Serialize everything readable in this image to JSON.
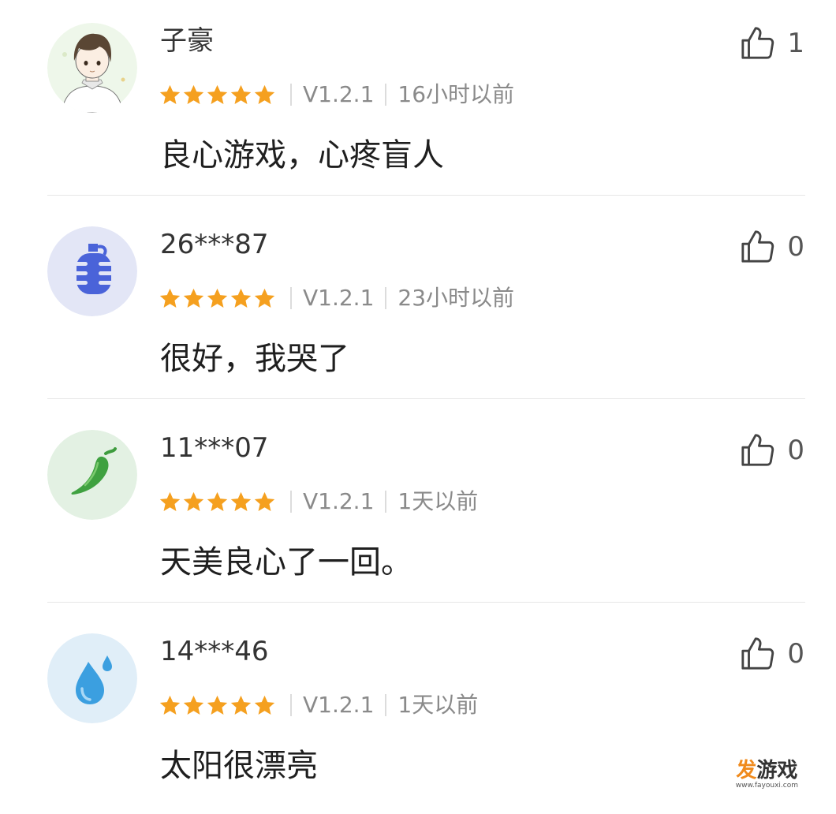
{
  "reviews": [
    {
      "username": "子豪",
      "avatar_icon": "boy-portrait-icon",
      "rating": 5,
      "version": "V1.2.1",
      "time": "16小时以前",
      "comment": "良心游戏，心疼盲人",
      "likes": "1"
    },
    {
      "username": "26***87",
      "avatar_icon": "grenade-icon",
      "rating": 5,
      "version": "V1.2.1",
      "time": "23小时以前",
      "comment": "很好，我哭了",
      "likes": "0"
    },
    {
      "username": "11***07",
      "avatar_icon": "chili-pepper-icon",
      "rating": 5,
      "version": "V1.2.1",
      "time": "1天以前",
      "comment": "天美良心了一回。",
      "likes": "0"
    },
    {
      "username": "14***46",
      "avatar_icon": "water-drop-icon",
      "rating": 5,
      "version": "V1.2.1",
      "time": "1天以前",
      "comment": "太阳很漂亮",
      "likes": "0"
    }
  ],
  "watermark": {
    "logo_a": "发",
    "logo_b": "游戏",
    "url": "www.fayouxi.com"
  },
  "colors": {
    "star": "#f5a01f",
    "meta_text": "#8a8a8a",
    "divider": "#e6e6e6",
    "avatar_bg_2": "#e3e6f6",
    "avatar_bg_3": "#e3f1e3",
    "avatar_bg_4": "#e0eef8"
  }
}
